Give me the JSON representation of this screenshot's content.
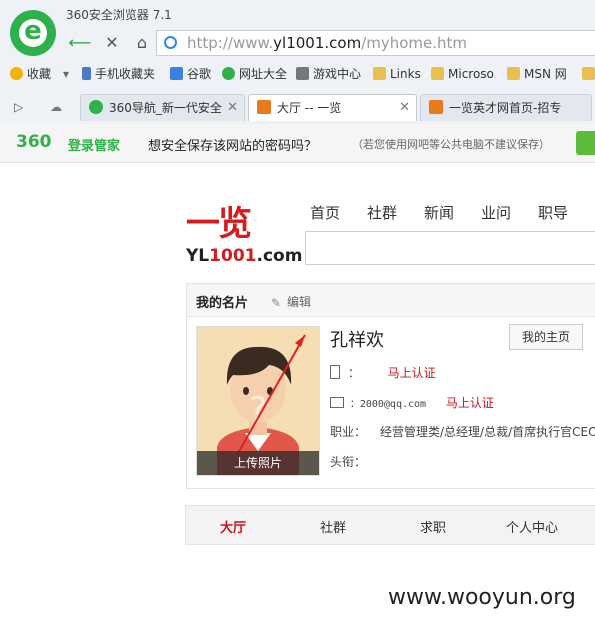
{
  "browser": {
    "title": "360安全浏览器 7.1",
    "url_prefix": "http://www.",
    "url_domain": "yl1001.com",
    "url_path": "/myhome.htm",
    "bookmarks": [
      {
        "label": "收藏"
      },
      {
        "label": "手机收藏夹"
      },
      {
        "label": "谷歌"
      },
      {
        "label": "网址大全"
      },
      {
        "label": "游戏中心"
      },
      {
        "label": "Links"
      },
      {
        "label": "Microso"
      },
      {
        "label": "MSN 网"
      }
    ],
    "tabs": [
      {
        "label": "360导航_新一代安全"
      },
      {
        "label": "大厅 -- 一览"
      },
      {
        "label": "一览英才网首页-招专"
      }
    ],
    "password_bar": {
      "brand": "360",
      "manager": "登录管家",
      "question": "想安全保存该网站的密码吗？",
      "hint": "（若您使用网吧等公共电脑不建议保存）"
    }
  },
  "site": {
    "logo_cn": "一览",
    "logo_en_prefix": "YL",
    "logo_en_num": "1001",
    "logo_en_suffix": ".com",
    "topnav": [
      "首页",
      "社群",
      "新闻",
      "业问",
      "职导"
    ]
  },
  "card": {
    "title": "我的名片",
    "edit_label": "编辑",
    "upload_label": "上传照片",
    "name": "孔祥欢",
    "home_button": "我的主页",
    "phone_colon": "：",
    "phone_verify": "马上认证",
    "email_value": "：2000@qq.com",
    "email_verify": "马上认证",
    "job_label": "职业：",
    "job_value": "经营管理类/总经理/总裁/首席执行官CEO",
    "title_label": "头衔："
  },
  "bottom_nav": [
    "大厅",
    "社群",
    "求职",
    "个人中心"
  ],
  "watermark": "www.wooyun.org",
  "colors": {
    "brand_red": "#c9151e",
    "browser_green": "#2eb14a"
  }
}
